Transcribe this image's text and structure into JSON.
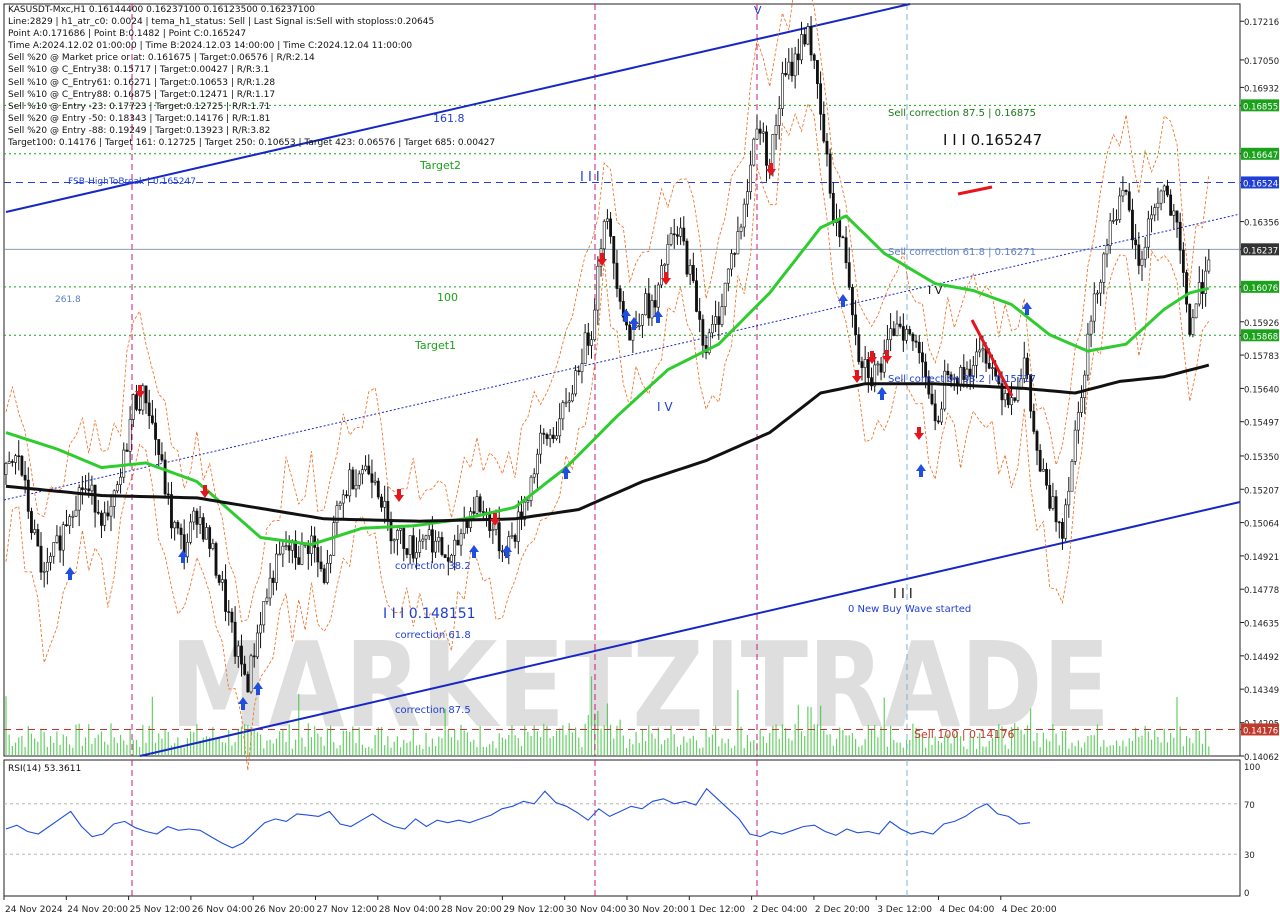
{
  "info_lines": [
    "KASUSDT-Mxc,H1  0.16144400 0.16237100 0.16123500 0.16237100",
    "Line:2829  | h1_atr_c0: 0.0024 | tema_h1_status: Sell | Last Signal is:Sell with stoploss:0.20645",
    "Point A:0.171686 | Point B:0.1482 | Point C:0.165247",
    "Time A:2024.12.02 01:00:00 | Time B:2024.12.03 14:00:00 | Time C:2024.12.04 11:00:00",
    "Sell %20 @ Market price or at: 0.161675 | Target:0.06576 | R/R:2.14",
    "Sell %10 @ C_Entry38: 0.15717 | Target:0.00427 | R/R:3.1",
    "Sell %10 @ C_Entry61: 0.16271 | Target:0.10653 | R/R:1.28",
    "Sell %10 @ C_Entry88: 0.16875 | Target:0.12471 | R/R:1.17",
    "Sell %10 @ Entry -23: 0.17723 | Target:0.12725 | R/R:1.71",
    "Sell %20 @ Entry -50: 0.18343 | Target:0.14176 | R/R:1.81",
    "Sell %20 @ Entry -88: 0.19249 | Target:0.13923 | R/R:3.82",
    "Target100: 0.14176 | Target 161: 0.12725 | Target 250: 0.10653 | Target 423: 0.06576 | Target 685: 0.00427"
  ],
  "chart_data": {
    "type": "candlestick",
    "symbol": "KASUSDT-Mxc,H1",
    "ylim": [
      0.14062,
      0.1729
    ],
    "y_ticks": [
      "0.17216",
      "0.17050",
      "0.16932",
      "0.16855",
      "0.16647",
      "0.16524",
      "0.16356",
      "0.16237",
      "0.16076",
      "0.15926",
      "0.15868",
      "0.15783",
      "0.15640",
      "0.15497",
      "0.15350",
      "0.15207",
      "0.15064",
      "0.14921",
      "0.14778",
      "0.14635",
      "0.14492",
      "0.14349",
      "0.14205",
      "0.14176",
      "0.14062"
    ],
    "y_tick_highlights": {
      "0.16855": "#1aa31a",
      "0.16647": "#1aa31a",
      "0.16524": "#1f3fd6",
      "0.16237": "#333333",
      "0.16076": "#1aa31a",
      "0.15868": "#1aa31a",
      "0.14176": "#c0392b"
    },
    "x_ticks": [
      "24 Nov 2024",
      "24 Nov 20:00",
      "25 Nov 12:00",
      "26 Nov 04:00",
      "26 Nov 20:00",
      "27 Nov 12:00",
      "28 Nov 04:00",
      "28 Nov 20:00",
      "29 Nov 12:00",
      "30 Nov 04:00",
      "30 Nov 20:00",
      "1 Dec 12:00",
      "2 Dec 04:00",
      "2 Dec 20:00",
      "3 Dec 12:00",
      "4 Dec 04:00",
      "4 Dec 20:00"
    ],
    "close_path": [
      [
        0,
        0.1527
      ],
      [
        4,
        0.1535
      ],
      [
        8,
        0.1505
      ],
      [
        12,
        0.1482
      ],
      [
        16,
        0.1496
      ],
      [
        20,
        0.1512
      ],
      [
        24,
        0.1522
      ],
      [
        28,
        0.1516
      ],
      [
        32,
        0.1505
      ],
      [
        36,
        0.1525
      ],
      [
        40,
        0.1558
      ],
      [
        44,
        0.1561
      ],
      [
        48,
        0.1536
      ],
      [
        52,
        0.1507
      ],
      [
        56,
        0.1495
      ],
      [
        60,
        0.1511
      ],
      [
        64,
        0.1497
      ],
      [
        68,
        0.1478
      ],
      [
        72,
        0.1452
      ],
      [
        76,
        0.1438
      ],
      [
        80,
        0.1466
      ],
      [
        84,
        0.1485
      ],
      [
        88,
        0.1496
      ],
      [
        92,
        0.1492
      ],
      [
        96,
        0.1499
      ],
      [
        100,
        0.1479
      ],
      [
        104,
        0.151
      ],
      [
        108,
        0.1525
      ],
      [
        112,
        0.153
      ],
      [
        116,
        0.1528
      ],
      [
        120,
        0.1505
      ],
      [
        124,
        0.15
      ],
      [
        128,
        0.1495
      ],
      [
        132,
        0.1503
      ],
      [
        136,
        0.1495
      ],
      [
        140,
        0.1489
      ],
      [
        144,
        0.1507
      ],
      [
        148,
        0.1515
      ],
      [
        152,
        0.1507
      ],
      [
        156,
        0.1495
      ],
      [
        160,
        0.1502
      ],
      [
        164,
        0.152
      ],
      [
        168,
        0.154
      ],
      [
        172,
        0.1545
      ],
      [
        176,
        0.1555
      ],
      [
        180,
        0.1575
      ],
      [
        184,
        0.159
      ],
      [
        188,
        0.164
      ],
      [
        192,
        0.1612
      ],
      [
        196,
        0.1585
      ],
      [
        200,
        0.16
      ],
      [
        204,
        0.1598
      ],
      [
        208,
        0.1625
      ],
      [
        212,
        0.163
      ],
      [
        216,
        0.1607
      ],
      [
        220,
        0.1581
      ],
      [
        224,
        0.1596
      ],
      [
        228,
        0.162
      ],
      [
        232,
        0.164
      ],
      [
        236,
        0.168
      ],
      [
        240,
        0.166
      ],
      [
        244,
        0.1695
      ],
      [
        248,
        0.1705
      ],
      [
        252,
        0.172
      ],
      [
        256,
        0.168
      ],
      [
        260,
        0.164
      ],
      [
        264,
        0.162
      ],
      [
        268,
        0.158
      ],
      [
        272,
        0.157
      ],
      [
        276,
        0.1575
      ],
      [
        280,
        0.1595
      ],
      [
        284,
        0.1585
      ],
      [
        288,
        0.158
      ],
      [
        292,
        0.1545
      ],
      [
        296,
        0.1575
      ],
      [
        300,
        0.1568
      ],
      [
        304,
        0.1575
      ],
      [
        308,
        0.158
      ],
      [
        312,
        0.1566
      ],
      [
        316,
        0.156
      ],
      [
        320,
        0.1575
      ],
      [
        324,
        0.1535
      ],
      [
        328,
        0.1515
      ],
      [
        332,
        0.1505
      ],
      [
        336,
        0.1545
      ],
      [
        340,
        0.1585
      ],
      [
        344,
        0.1615
      ],
      [
        348,
        0.164
      ],
      [
        352,
        0.1645
      ],
      [
        356,
        0.1615
      ],
      [
        360,
        0.164
      ],
      [
        364,
        0.165
      ],
      [
        368,
        0.163
      ],
      [
        372,
        0.159
      ],
      [
        376,
        0.161
      ],
      [
        378,
        0.1624
      ]
    ],
    "ema_path": [
      [
        0,
        0.1545
      ],
      [
        16,
        0.1538
      ],
      [
        30,
        0.153
      ],
      [
        44,
        0.1532
      ],
      [
        60,
        0.1524
      ],
      [
        80,
        0.15
      ],
      [
        96,
        0.1497
      ],
      [
        112,
        0.1504
      ],
      [
        128,
        0.1505
      ],
      [
        144,
        0.1508
      ],
      [
        160,
        0.1513
      ],
      [
        176,
        0.153
      ],
      [
        192,
        0.1552
      ],
      [
        208,
        0.1572
      ],
      [
        224,
        0.1583
      ],
      [
        240,
        0.1605
      ],
      [
        256,
        0.1633
      ],
      [
        264,
        0.1638
      ],
      [
        276,
        0.1622
      ],
      [
        292,
        0.1609
      ],
      [
        304,
        0.1606
      ],
      [
        316,
        0.16
      ],
      [
        328,
        0.1587
      ],
      [
        340,
        0.158
      ],
      [
        352,
        0.1583
      ],
      [
        364,
        0.1598
      ],
      [
        372,
        0.1605
      ],
      [
        378,
        0.1607
      ]
    ],
    "ma_path": [
      [
        0,
        0.1522
      ],
      [
        30,
        0.1518
      ],
      [
        60,
        0.1517
      ],
      [
        100,
        0.1508
      ],
      [
        130,
        0.1507
      ],
      [
        160,
        0.1508
      ],
      [
        180,
        0.1512
      ],
      [
        200,
        0.1524
      ],
      [
        220,
        0.1533
      ],
      [
        240,
        0.1545
      ],
      [
        256,
        0.1562
      ],
      [
        270,
        0.1566
      ],
      [
        292,
        0.1566
      ],
      [
        320,
        0.1564
      ],
      [
        336,
        0.1562
      ],
      [
        350,
        0.1567
      ],
      [
        364,
        0.1569
      ],
      [
        378,
        0.1574
      ]
    ],
    "levels": [
      {
        "price": 0.16855,
        "color": "#1aa31a",
        "style": "dotted"
      },
      {
        "price": 0.16647,
        "color": "#1aa31a",
        "style": "dotted"
      },
      {
        "price": 0.16524,
        "color": "#1f3fd6",
        "style": "dashed"
      },
      {
        "price": 0.16237,
        "color": "#7a8fa8",
        "style": "solid"
      },
      {
        "price": 0.16076,
        "color": "#1aa31a",
        "style": "dotted"
      },
      {
        "price": 0.15868,
        "color": "#1aa31a",
        "style": "dotted"
      },
      {
        "price": 0.14176,
        "color": "#c0392b",
        "style": "dashed"
      }
    ],
    "annotations": [
      {
        "text": "FSB-HighToBreak | 0.165247",
        "color": "#1f3fd6"
      },
      {
        "text": "161.8",
        "color": "#1f3fd6"
      },
      {
        "text": "261.8",
        "color": "#5c7ecc"
      },
      {
        "text": "Target2",
        "color": "#1aa31a"
      },
      {
        "text": "100",
        "color": "#1aa31a"
      },
      {
        "text": "Target1",
        "color": "#1aa31a"
      },
      {
        "text": "correction 38.2",
        "color": "#1f3fd6"
      },
      {
        "text": "I I I 0.148151",
        "color": "#1f3fd6"
      },
      {
        "text": "correction 61.8",
        "color": "#1f3fd6"
      },
      {
        "text": "correction 87.5",
        "color": "#1f3fd6"
      },
      {
        "text": "I I I",
        "color": "#1f3fd6"
      },
      {
        "text": "I V",
        "color": "#1f3fd6"
      },
      {
        "text": "V",
        "color": "#1f3fd6"
      },
      {
        "text": "Sell correction 87.5 | 0.16875",
        "color": "#1a7a1a"
      },
      {
        "text": "I I I 0.165247",
        "color": "#111111"
      },
      {
        "text": "Sell correction 61.8 | 0.16271",
        "color": "#5c7ecc"
      },
      {
        "text": "I V",
        "color": "#111111"
      },
      {
        "text": "Sell correction 38.2 | 0.15717",
        "color": "#1f3fd6"
      },
      {
        "text": "0 New Buy Wave started",
        "color": "#1f3fd6"
      },
      {
        "text": "I I I",
        "color": "#111111"
      },
      {
        "text": "Sell 100 | 0.14176",
        "color": "#c0392b"
      }
    ],
    "rsi": {
      "label": "RSI(14) 53.3611",
      "ylim": [
        0,
        100
      ],
      "levels": [
        "100",
        "70",
        "30",
        "0"
      ],
      "values": [
        50,
        53,
        48,
        46,
        52,
        58,
        64,
        52,
        44,
        46,
        54,
        56,
        51,
        48,
        46,
        52,
        49,
        50,
        49,
        44,
        39,
        35,
        39,
        47,
        55,
        58,
        56,
        62,
        61,
        60,
        64,
        54,
        52,
        57,
        62,
        56,
        52,
        50,
        58,
        52,
        57,
        55,
        57,
        55,
        58,
        61,
        66,
        68,
        72,
        70,
        80,
        71,
        68,
        63,
        57,
        66,
        60,
        64,
        68,
        66,
        72,
        74,
        70,
        72,
        69,
        82,
        74,
        66,
        58,
        46,
        44,
        48,
        46,
        49,
        52,
        53,
        48,
        45,
        50,
        47,
        48,
        46,
        56,
        50,
        46,
        48,
        46,
        54,
        56,
        60,
        66,
        70,
        62,
        60,
        54,
        55
      ]
    },
    "watermark": "MARKETZITRADE"
  }
}
